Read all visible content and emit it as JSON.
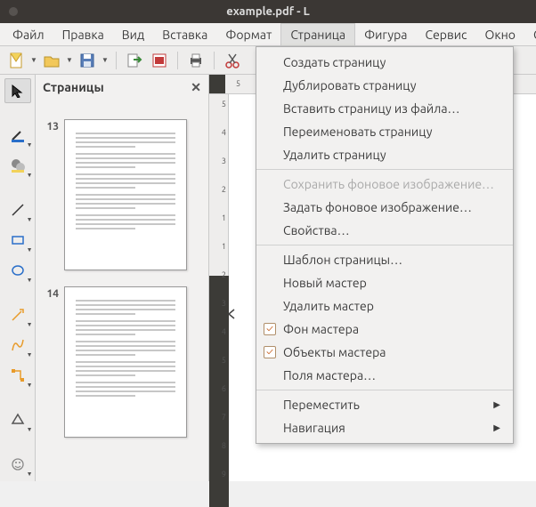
{
  "window": {
    "title": "example.pdf - L"
  },
  "menubar": {
    "items": [
      "Файл",
      "Правка",
      "Вид",
      "Вставка",
      "Формат",
      "Страница",
      "Фигура",
      "Сервис",
      "Окно",
      "Справка"
    ],
    "activeIndex": 5
  },
  "panel": {
    "title": "Страницы",
    "thumbs": [
      {
        "num": "13"
      },
      {
        "num": "14"
      }
    ]
  },
  "ruler_h": [
    "5"
  ],
  "ruler_v": [
    "5",
    "4",
    "3",
    "2",
    "1",
    "1",
    "2",
    "3",
    "4",
    "5",
    "6",
    "7",
    "8",
    "9"
  ],
  "page_menu": {
    "items": [
      {
        "label": "Создать страницу",
        "type": "item"
      },
      {
        "label": "Дублировать страницу",
        "type": "item"
      },
      {
        "label": "Вставить страницу из файла…",
        "type": "item"
      },
      {
        "label": "Переименовать страницу",
        "type": "item"
      },
      {
        "label": "Удалить страницу",
        "type": "item"
      },
      {
        "type": "sep"
      },
      {
        "label": "Сохранить фоновое изображение…",
        "type": "item",
        "disabled": true
      },
      {
        "label": "Задать фоновое изображение…",
        "type": "item"
      },
      {
        "label": "Свойства…",
        "type": "item"
      },
      {
        "type": "sep"
      },
      {
        "label": "Шаблон страницы…",
        "type": "item"
      },
      {
        "label": "Новый мастер",
        "type": "item"
      },
      {
        "label": "Удалить мастер",
        "type": "item"
      },
      {
        "label": "Фон мастера",
        "type": "check",
        "checked": true
      },
      {
        "label": "Объекты мастера",
        "type": "check",
        "checked": true
      },
      {
        "label": "Поля мастера…",
        "type": "item"
      },
      {
        "type": "sep"
      },
      {
        "label": "Переместить",
        "type": "submenu"
      },
      {
        "label": "Навигация",
        "type": "submenu"
      }
    ]
  }
}
